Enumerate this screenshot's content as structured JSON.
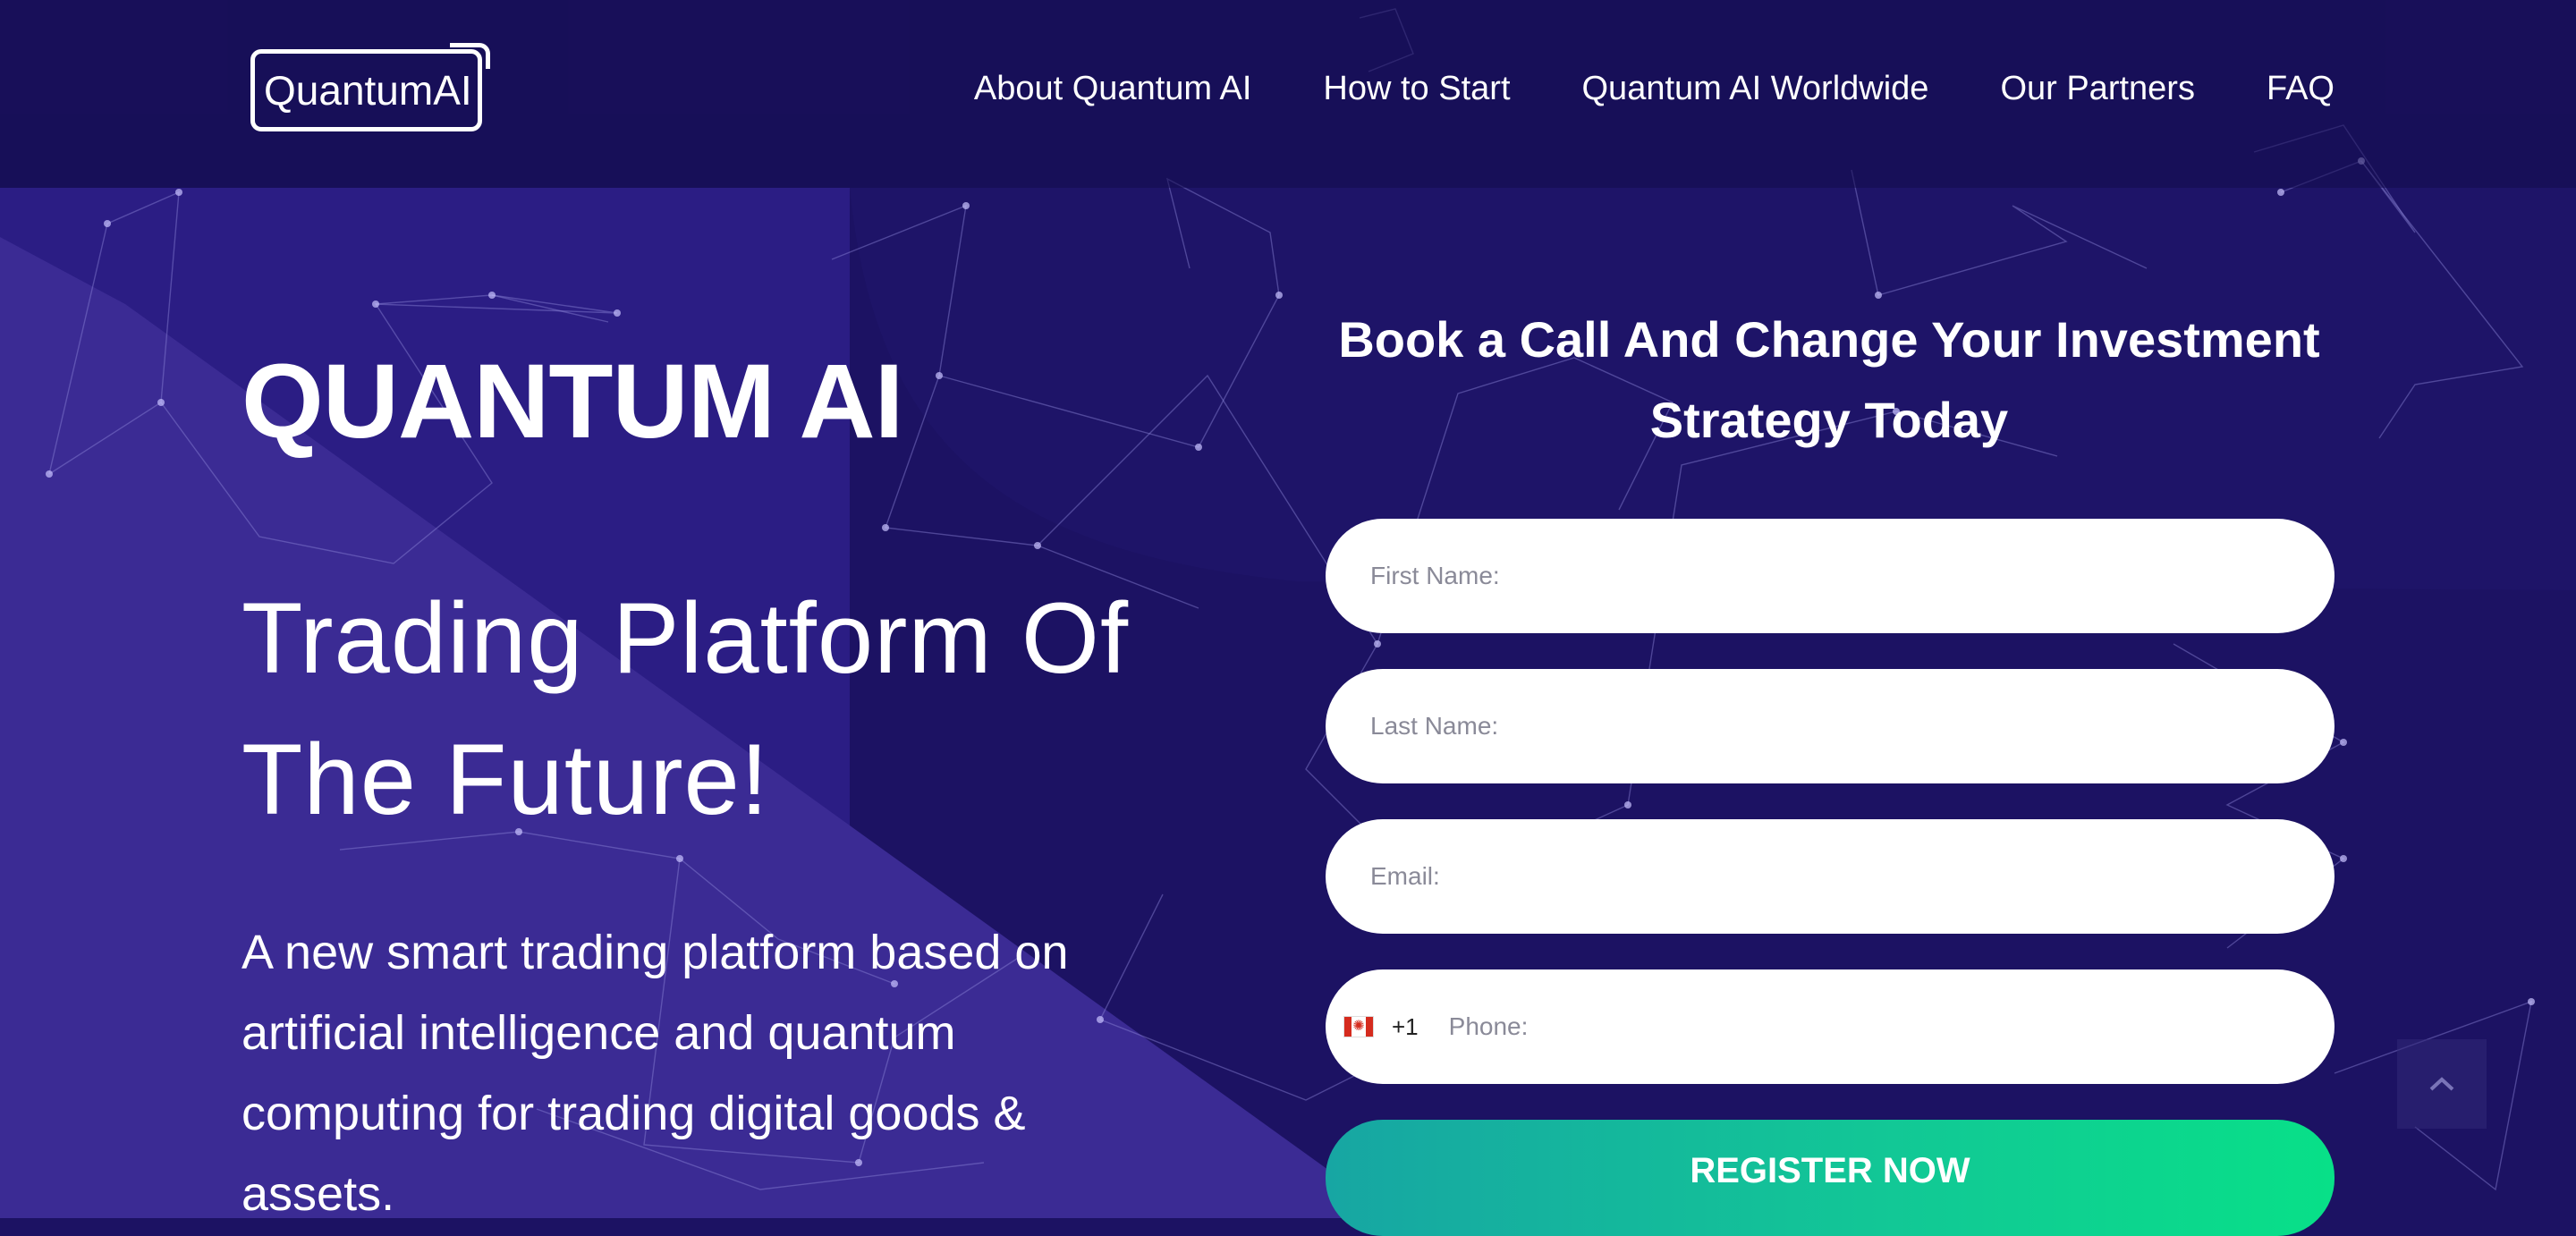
{
  "header": {
    "logo_text": "QuantumAI",
    "nav": [
      {
        "label": "About Quantum AI"
      },
      {
        "label": "How to Start"
      },
      {
        "label": "Quantum AI Worldwide"
      },
      {
        "label": "Our Partners"
      },
      {
        "label": "FAQ"
      }
    ]
  },
  "hero": {
    "title": "QUANTUM AI",
    "subtitle": "Trading Platform Of The Future!",
    "description": "A new smart trading platform based on artificial intelligence and quantum computing for trading digital goods & assets."
  },
  "form": {
    "title": "Book a Call And Change Your Investment Strategy Today",
    "first_name_placeholder": "First Name:",
    "last_name_placeholder": "Last Name:",
    "email_placeholder": "Email:",
    "phone_country_icon": "canada-flag-icon",
    "phone_code": "+1",
    "phone_placeholder": "Phone:",
    "submit_label": "REGISTER NOW"
  },
  "scroll_top_icon": "chevron-up-icon",
  "colors": {
    "background": "#1c1263",
    "header": "#150c50",
    "diagonal_band": "#3b2b94",
    "button_gradient_start": "#17a6a3",
    "button_gradient_end": "#08e088"
  }
}
